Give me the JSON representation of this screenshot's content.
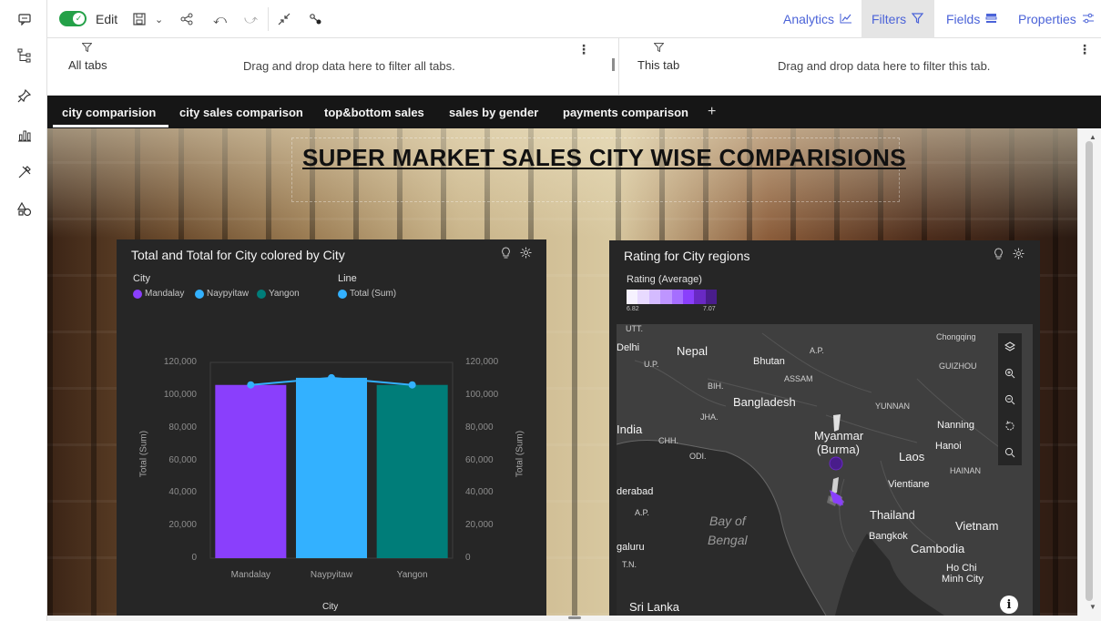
{
  "toolbar": {
    "edit_label": "Edit",
    "actions": [
      {
        "label": "Analytics",
        "icon": "line-chart-icon"
      },
      {
        "label": "Filters",
        "icon": "filter-icon",
        "active": true
      },
      {
        "label": "Fields",
        "icon": "fields-icon"
      },
      {
        "label": "Properties",
        "icon": "sliders-icon"
      }
    ]
  },
  "filters": {
    "all_tabs_label": "All tabs",
    "all_tabs_hint": "Drag and drop data here to filter all tabs.",
    "this_tab_label": "This tab",
    "this_tab_hint": "Drag and drop data here to filter this tab."
  },
  "tabs": [
    {
      "label": "city comparision",
      "active": true
    },
    {
      "label": "city sales comparison"
    },
    {
      "label": "top&bottom sales"
    },
    {
      "label": "sales by gender"
    },
    {
      "label": "payments comparison"
    }
  ],
  "tab_add": "+",
  "dashboard": {
    "title": "SUPER MARKET SALES CITY WISE COMPARISIONS"
  },
  "bar_widget": {
    "title": "Total and Total for City colored by City",
    "legend_city_head": "City",
    "legend_line_head": "Line",
    "legend_city": [
      {
        "name": "Mandalay",
        "color": "#8a3ffc"
      },
      {
        "name": "Naypyitaw",
        "color": "#33b1ff"
      },
      {
        "name": "Yangon",
        "color": "#007d79"
      }
    ],
    "legend_line": [
      {
        "name": "Total (Sum)",
        "color": "#33b1ff"
      }
    ]
  },
  "chart_data": {
    "type": "bar",
    "categories": [
      "Mandalay",
      "Naypyitaw",
      "Yangon"
    ],
    "series": [
      {
        "name": "Total (Sum)",
        "kind": "bar",
        "values": [
          106197,
          110569,
          106200
        ],
        "colors": [
          "#8a3ffc",
          "#33b1ff",
          "#007d79"
        ]
      },
      {
        "name": "Total (Sum)",
        "kind": "line",
        "values": [
          106197,
          110569,
          106200
        ],
        "color": "#33b1ff"
      }
    ],
    "xlabel": "City",
    "ylabel": "Total (Sum)",
    "y2label": "Total (Sum)",
    "yticks": [
      "120,000",
      "100,000",
      "80,000",
      "60,000",
      "40,000",
      "20,000",
      "0"
    ],
    "ylim": [
      0,
      120000
    ],
    "grid": false
  },
  "map_widget": {
    "title": "Rating for City regions",
    "legend_head": "Rating (Average)",
    "legend_min": "6.82",
    "legend_max": "7.07",
    "places": [
      {
        "name": "UTT.",
        "cls": "small"
      },
      {
        "name": "Chongqing",
        "cls": "small"
      },
      {
        "name": "Delhi",
        "cls": ""
      },
      {
        "name": "Nepal",
        "cls": "big"
      },
      {
        "name": "A.P.",
        "cls": "small"
      },
      {
        "name": "U.P.",
        "cls": "small"
      },
      {
        "name": "Bhutan",
        "cls": ""
      },
      {
        "name": "GUIZHOU",
        "cls": "small"
      },
      {
        "name": "ASSAM",
        "cls": "small"
      },
      {
        "name": "BIH.",
        "cls": "small"
      },
      {
        "name": "Bangladesh",
        "cls": "big"
      },
      {
        "name": "JHA.",
        "cls": "small"
      },
      {
        "name": "YUNNAN",
        "cls": "small"
      },
      {
        "name": "India",
        "cls": "big"
      },
      {
        "name": "Nanning",
        "cls": ""
      },
      {
        "name": "Myanmar",
        "cls": "big"
      },
      {
        "name": "(Burma)",
        "cls": "big"
      },
      {
        "name": "CHH.",
        "cls": "small"
      },
      {
        "name": "Hanoi",
        "cls": ""
      },
      {
        "name": "ODI.",
        "cls": "small"
      },
      {
        "name": "Laos",
        "cls": "big"
      },
      {
        "name": "HAINAN",
        "cls": "small"
      },
      {
        "name": "Vientiane",
        "cls": ""
      },
      {
        "name": "derabad",
        "cls": ""
      },
      {
        "name": "A.P.",
        "cls": "small"
      },
      {
        "name": "Thailand",
        "cls": "big"
      },
      {
        "name": "Vietnam",
        "cls": "big"
      },
      {
        "name": "Bay of",
        "cls": "water"
      },
      {
        "name": "Bengal",
        "cls": "water"
      },
      {
        "name": "Bangkok",
        "cls": ""
      },
      {
        "name": "galuru",
        "cls": ""
      },
      {
        "name": "Cambodia",
        "cls": "big"
      },
      {
        "name": "T.N.",
        "cls": "small"
      },
      {
        "name": "Ho Chi",
        "cls": ""
      },
      {
        "name": "Minh City",
        "cls": ""
      },
      {
        "name": "Sri Lanka",
        "cls": "big"
      }
    ]
  }
}
